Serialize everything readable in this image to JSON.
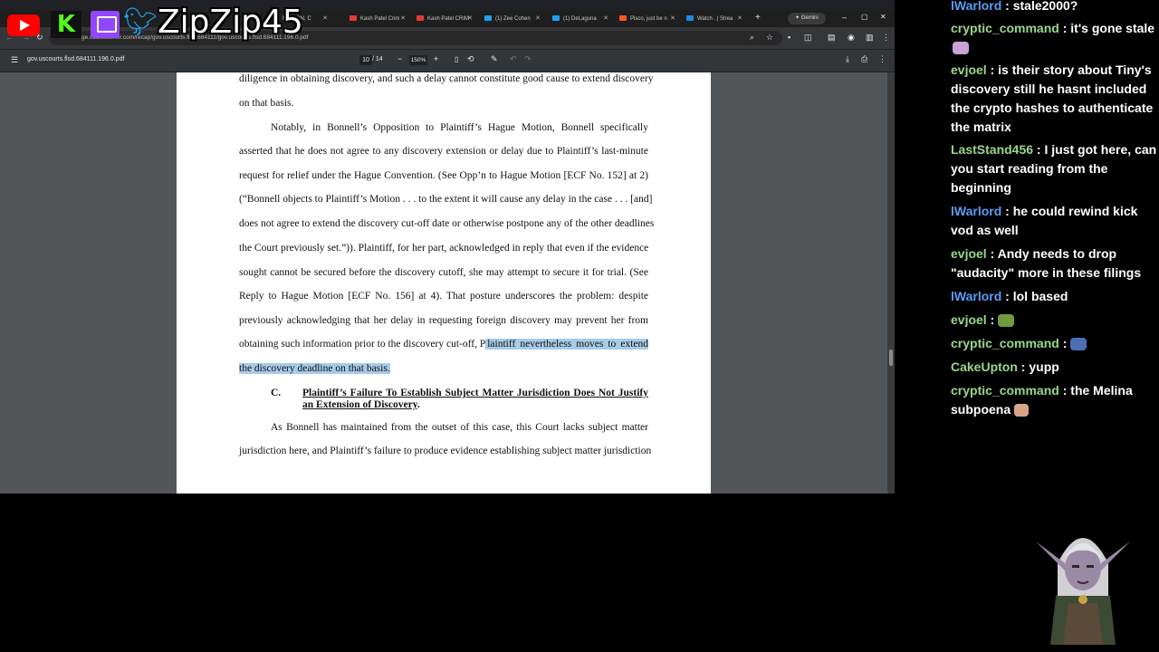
{
  "overlay": {
    "channel_name": "ZipZip45",
    "logos": [
      "youtube-logo",
      "kick-logo",
      "twitch-logo",
      "twitter-logo"
    ]
  },
  "browser": {
    "tabs": [
      {
        "label": "MILLION, C",
        "color": "#9e9e9e"
      },
      {
        "label": "Kash Patel Crim",
        "color": "#e53935"
      },
      {
        "label": "Kash Patel CRIM",
        "color": "#e53935"
      },
      {
        "label": "(1) Zee Cohen",
        "color": "#1da1f2"
      },
      {
        "label": "(1) DeLaguna",
        "color": "#1da1f2"
      },
      {
        "label": "Pisco, just be n",
        "color": "#ff5722"
      },
      {
        "label": "Watch . | Strea",
        "color": "#1e88e5"
      }
    ],
    "gemini_label": "Gemini",
    "url": "ge.courtlistener.com/recap/gov.uscourts.flsd.684111/gov.uscourts.flsd.684111.196.0.pdf",
    "pdf": {
      "filename": "gov.uscourts.flsd.684111.196.0.pdf",
      "page_current": "10",
      "page_total": "/ 14",
      "zoom": "150%"
    }
  },
  "document": {
    "lines": [
      "diligence in obtaining discovery, and such a delay cannot constitute good cause to extend discovery",
      "on that basis.",
      "Notably, in Bonnell’s Opposition to Plaintiff’s Hague Motion, Bonnell specifically",
      "asserted that he does not agree to any discovery extension or delay due to Plaintiff’s last-minute",
      "request for relief under the Hague Convention. (See Opp’n to Hague Motion [ECF No. 152] at 2)",
      "(“Bonnell objects to Plaintiff’s Motion . . . to the extent it will cause any delay in the case . . . [and]",
      "does not agree to extend the discovery cut-off date or otherwise postpone any of the other deadlines",
      "the Court previously set.”)). Plaintiff, for her part, acknowledged in reply that even if the evidence",
      "sought cannot be secured before the discovery cutoff, she may attempt to secure it for trial. (See",
      "Reply to Hague Motion [ECF No. 156] at 4). That posture underscores the problem: despite",
      "previously acknowledging that her delay in requesting foreign discovery may prevent her from"
    ],
    "line_hl_plain": "obtaining such information prior to the discovery cut-off, P",
    "line_hl_marked": "laintiff nevertheless moves to extend",
    "line_hl2": "the discovery deadline on that basis.",
    "section_letter": "C.",
    "section_title_1": "Plaintiff’s Failure To Establish Subject Matter Jurisdiction Does Not Justify",
    "section_title_2": "an Extension of Discovery",
    "section_title_end": ".",
    "para2_lines": [
      "As Bonnell has maintained from the outset of this case, this Court lacks subject matter",
      "jurisdiction here, and Plaintiff’s failure to produce evidence establishing subject matter jurisdiction"
    ]
  },
  "chat": {
    "messages": [
      {
        "user": "lWarlord",
        "color": "#5b9cf5",
        "text": "stale2000?"
      },
      {
        "user": "cryptic_command",
        "color": "#9ad68a",
        "text": "it's gone stale",
        "emote": "pink-emote"
      },
      {
        "user": "evjoel",
        "color": "#9ad68a",
        "text": "is their story about Tiny's discovery still he hasnt included the crypto hashes to authenticate the matrix"
      },
      {
        "user": "LastStand456",
        "color": "#9ad68a",
        "text": "I just got here, can you start reading from the beginning"
      },
      {
        "user": "lWarlord",
        "color": "#5b9cf5",
        "text": "he could rewind kick vod as well"
      },
      {
        "user": "evjoel",
        "color": "#9ad68a",
        "text": "Andy needs to drop \"audacity\" more in these filings"
      },
      {
        "user": "lWarlord",
        "color": "#5b9cf5",
        "text": "lol based"
      },
      {
        "user": "evjoel",
        "color": "#9ad68a",
        "text": "",
        "emote": "frog-emote"
      },
      {
        "user": "cryptic_command",
        "color": "#9ad68a",
        "text": "",
        "emote": "blue-character-emote"
      },
      {
        "user": "CakeUpton",
        "color": "#9ad68a",
        "text": "yupp"
      },
      {
        "user": "cryptic_command",
        "color": "#9ad68a",
        "text": "the Melina subpoena",
        "emote": "face-emote"
      }
    ]
  },
  "colors": {
    "highlight": "#a8cbe8",
    "user_blue": "#5b9cf5",
    "user_green": "#9ad68a",
    "pdf_toolbar": "#323639",
    "viewer_bg": "#525659"
  }
}
